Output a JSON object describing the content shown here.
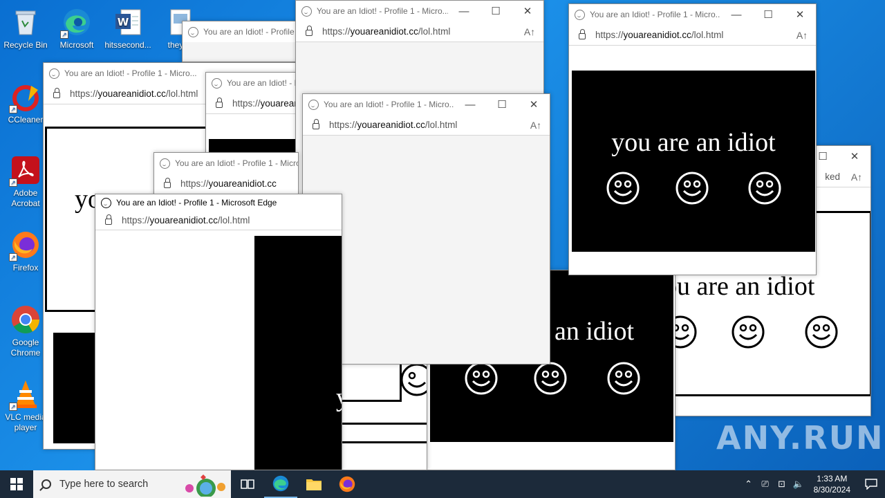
{
  "desktop_icons": [
    {
      "label": "Recycle Bin",
      "icon": "recycle-bin-icon"
    },
    {
      "label": "Microsoft",
      "icon": "edge-icon"
    },
    {
      "label": "hitssecond...",
      "icon": "word-icon"
    },
    {
      "label": "theyth",
      "icon": "image-file-icon"
    },
    {
      "label": "CCleaner",
      "icon": "ccleaner-icon"
    },
    {
      "label": "Adobe Acrobat",
      "icon": "acrobat-icon"
    },
    {
      "label": "Firefox",
      "icon": "firefox-icon"
    },
    {
      "label": "Google Chrome",
      "icon": "chrome-icon"
    },
    {
      "label": "VLC media player",
      "icon": "vlc-icon"
    }
  ],
  "browser": {
    "title_full": "You are an Idiot! - Profile 1 - Microsoft Edge",
    "title_short": "You are an Idiot! - Profile 1 - Micro...",
    "url_prefix": "https://",
    "url_domain": "youareanidiot.cc",
    "url_path": "/lol.html",
    "minimize": "—",
    "maximize": "☐",
    "close": "✕",
    "read_aloud": "A↑",
    "blocked_fragment": "ked"
  },
  "page_text": "you are an idiot",
  "page_text_partial": "an idiot",
  "page_text_partial2": "ou are an idiot",
  "page_text_partial3": "y",
  "taskbar": {
    "search_placeholder": "Type here to search",
    "time": "1:33 AM",
    "date": "8/30/2024"
  },
  "watermark": "ANY.RUN"
}
